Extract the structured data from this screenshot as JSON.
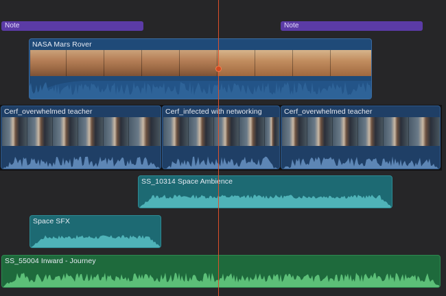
{
  "timeline": {
    "notes": [
      {
        "label": "Note"
      },
      {
        "label": "Note"
      }
    ],
    "connected_video": {
      "label": "NASA Mars Rover"
    },
    "primary_clips": [
      {
        "label": "Cerf_overwhelmed teacher"
      },
      {
        "label": "Cerf_infected with networking"
      },
      {
        "label": "Cerf_overwhelmed teacher"
      }
    ],
    "audio_clips": [
      {
        "label": "SS_10314 Space Ambience"
      },
      {
        "label": "Space SFX"
      },
      {
        "label": "SS_55004 Inward - Journey"
      }
    ]
  },
  "colors": {
    "playhead": "#e0502a",
    "note": "#5b3ba6",
    "video_clip": "#1f4a78",
    "audio_teal": "#1d6a73",
    "audio_green": "#1e6a3c"
  }
}
